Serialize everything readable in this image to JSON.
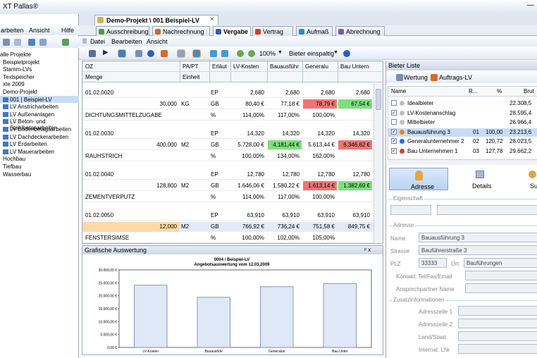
{
  "app": {
    "title": "XT Pallas®"
  },
  "menu": {
    "items": [
      "arbeiten",
      "Ansicht",
      "Hilfe"
    ]
  },
  "tree": {
    "items": [
      "alle Projekte",
      "Beispielprojekt",
      "Stamm-LVs",
      "Textspeicher",
      "xte 2009",
      "Demo-Projekt",
      "001 | Beispiel-LV",
      "LV Anstricharbeiten",
      "LV Außenanlagen",
      "LV Beton- und Stahlbetonarbeiten",
      "LV Bodenbelagsarbeiten",
      "LV Dachdeckerarbeiten",
      "LV Erdarbeiten",
      "LV Mauerarbeiten",
      "Hochbau",
      "Tiefbau",
      "Wasserbau"
    ]
  },
  "doc": {
    "tab": "Demo-Projekt \\ 001 Beispiel-LV",
    "close": "×"
  },
  "modules": [
    "Ausschreibung",
    "Nachrechnung",
    "Vergabe",
    "Vertrag",
    "Aufmaß",
    "Abrechnung"
  ],
  "submenu": [
    "Datei",
    "Bearbeiten",
    "Ansicht"
  ],
  "toolbar": {
    "zoom": "100%",
    "mode": "Bieter einspaltig"
  },
  "grid": {
    "headers1": [
      "OZ",
      "PA/PT",
      "Erläut",
      "LV-Kosten",
      "Bauausführ",
      "Generalu",
      "Bau Untern"
    ],
    "headers2": [
      "Menge",
      "Einheit"
    ],
    "rows": [
      {
        "a": "01.02.0020",
        "b": "",
        "c": "EP",
        "v": [
          "2,680",
          "2,680",
          "2,680",
          "2,680"
        ],
        "hl": [
          0,
          0,
          0,
          0
        ]
      },
      {
        "a": "30,000",
        "b": "KG",
        "c": "GB",
        "v": [
          "80,40 €",
          "77,18 €",
          "78,79 €",
          "67,54 €"
        ],
        "hl": [
          0,
          0,
          1,
          2
        ],
        "right": true
      },
      {
        "a": "DICHTUNGSMITTELZUGABE",
        "b": "",
        "c": "%",
        "v": [
          "114,00%",
          "117,00%",
          "100,00%",
          ""
        ],
        "hl": [
          0,
          0,
          0,
          0
        ],
        "shift": true
      },
      {
        "a": "01.02.0030",
        "b": "",
        "c": "EP",
        "v": [
          "14,320",
          "14,320",
          "14,320",
          "14,320"
        ],
        "hl": [
          0,
          0,
          0,
          0
        ]
      },
      {
        "a": "400,000",
        "b": "M2",
        "c": "GB",
        "v": [
          "5.728,00 €",
          "4.181,44 €",
          "5.613,44 €",
          "6.346,62 €"
        ],
        "hl": [
          0,
          2,
          0,
          1
        ],
        "right": true
      },
      {
        "a": "RAUHSTRICH",
        "b": "",
        "c": "%",
        "v": [
          "100,00%",
          "134,00%",
          "162,00%",
          ""
        ],
        "hl": [
          0,
          0,
          0,
          0
        ],
        "shift": true
      },
      {
        "a": "01.02.0040",
        "b": "",
        "c": "EP",
        "v": [
          "12,780",
          "12,780",
          "12,780",
          "12,780"
        ],
        "hl": [
          0,
          0,
          0,
          0
        ]
      },
      {
        "a": "128,800",
        "b": "M2",
        "c": "GB",
        "v": [
          "1.646,06 €",
          "1.580,22 €",
          "1.613,14 €",
          "1.382,69 €"
        ],
        "hl": [
          0,
          0,
          1,
          2
        ],
        "right": true
      },
      {
        "a": "ZEMENTVERPUTZ",
        "b": "",
        "c": "%",
        "v": [
          "114,00%",
          "117,00%",
          "100,00%",
          ""
        ],
        "hl": [
          0,
          0,
          0,
          0
        ],
        "shift": true
      },
      {
        "a": "01.02.0050",
        "b": "",
        "c": "EP",
        "v": [
          "63,910",
          "63,910",
          "63,910",
          "63,910"
        ],
        "hl": [
          0,
          0,
          0,
          0
        ]
      },
      {
        "a": "12,000",
        "b": "M2",
        "c": "GB",
        "v": [
          "766,92 €",
          "736,24 €",
          "751,58 €",
          "849,75 €"
        ],
        "hl": [
          0,
          0,
          0,
          0
        ],
        "right": true,
        "sel": true
      },
      {
        "a": "FENSTERSIMSE",
        "b": "",
        "c": "%",
        "v": [
          "100,00%",
          "102,00%",
          "105,00%",
          ""
        ],
        "hl": [
          0,
          0,
          0,
          0
        ],
        "shift": true
      }
    ]
  },
  "chartpanel": {
    "title": "Grafische Auswertung",
    "pin": "ᵖ x"
  },
  "chart_data": {
    "type": "bar",
    "title": "0004 / Beispiel-LV",
    "subtitle": "Angebotsauswertung vom 12.03.2009",
    "categories": [
      "LV-Kosten",
      "Bauausführ",
      "Generalun",
      "Bau Unter"
    ],
    "values": [
      24100,
      19400,
      23500,
      24700
    ],
    "ylim": [
      0,
      30000
    ],
    "yticks": [
      "30.000,00 €",
      "25.000,00 €",
      "20.000,00 €",
      "15.000,00 €",
      "10.000,00 €",
      "5.000,00 €",
      "0,00 €"
    ]
  },
  "bieter": {
    "title": "Bieter Liste",
    "tb_wertung": "Wertung",
    "tb_auftrag": "Auftrags-LV",
    "cols": [
      "Name",
      "R...",
      "%",
      "Brut"
    ],
    "rows": [
      {
        "name": "Idealbieter",
        "r": "",
        "p": "",
        "b": "22.308,5",
        "chk": false,
        "dot": "#c0c0c0",
        "bold": false
      },
      {
        "name": "LV-Kostenanschlag",
        "r": "",
        "p": "",
        "b": "28.595,4",
        "chk": true,
        "dot": "#c0c0c0",
        "bold": false
      },
      {
        "name": "Mittelbieter",
        "r": "",
        "p": "",
        "b": "26.966,4",
        "chk": false,
        "dot": "#c0c0c0",
        "bold": false
      },
      {
        "name": "Bauausführung 3",
        "r": "01",
        "p": "100,00",
        "b": "23.213,6",
        "chk": true,
        "dot": "#d88a2a",
        "bold": false,
        "sel": true
      },
      {
        "name": "Generalunternehmer 2",
        "r": "02",
        "p": "120,72",
        "b": "28.023,5",
        "chk": true,
        "dot": "#2a6fd8",
        "bold": false
      },
      {
        "name": "Bau Unternehmen 1",
        "r": "03",
        "p": "127,78",
        "b": "29.662,2",
        "chk": true,
        "dot": "#d83a2a",
        "bold": false
      }
    ]
  },
  "btns": [
    "Adresse",
    "Details",
    "Su"
  ],
  "form": {
    "eigenschaft": "Eigenschaft",
    "adresse": "Adresse",
    "name_l": "Name",
    "name_v": "Bauausführung 3",
    "strasse_l": "Strasse",
    "strasse_v": "Bauführerstraße 3",
    "plz_l": "PLZ",
    "plz_v": "33333",
    "ort_l": "Ort",
    "ort_v": "Bauführungen",
    "kontakt": "Kontakt: Tel/Fax/Email",
    "ansprech": "Ansprechpartner Name",
    "zusatz": "Zusatzinformationen",
    "az1": "Adresszeile 1",
    "az2": "Adresszeile 2",
    "land": "Land/Staat",
    "inet": "Internat. LNr"
  },
  "colors": {
    "green": "#7ce07c",
    "red": "#ef7474",
    "sel": "#fcd9a6",
    "bar": "#dfe8f6"
  }
}
